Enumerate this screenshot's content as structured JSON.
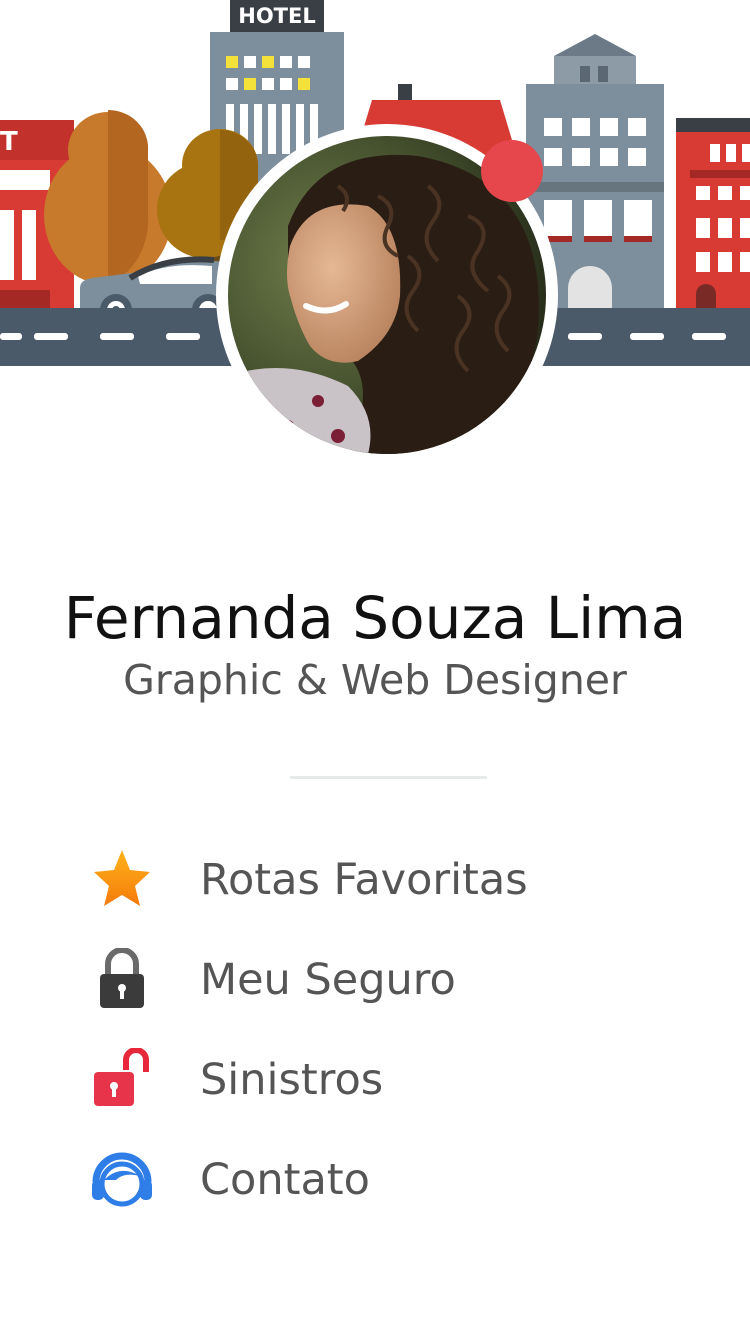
{
  "profile": {
    "name": "Fernanda Souza Lima",
    "role": "Graphic & Web Designer",
    "status_color": "#e5474d"
  },
  "header": {
    "hotel_sign": "HOTEL",
    "shop_sign_fragment": "T"
  },
  "menu": {
    "items": [
      {
        "label": "Rotas Favoritas",
        "icon": "star-icon"
      },
      {
        "label": "Meu Seguro",
        "icon": "lock-closed-icon"
      },
      {
        "label": "Sinistros",
        "icon": "lock-open-icon"
      },
      {
        "label": "Contato",
        "icon": "headset-icon"
      }
    ]
  },
  "colors": {
    "road": "#4b5a68",
    "building_blue": "#7d8e9c",
    "building_red": "#d83a34",
    "tree_orange": "#c87a2c",
    "accent_text": "#555555"
  }
}
